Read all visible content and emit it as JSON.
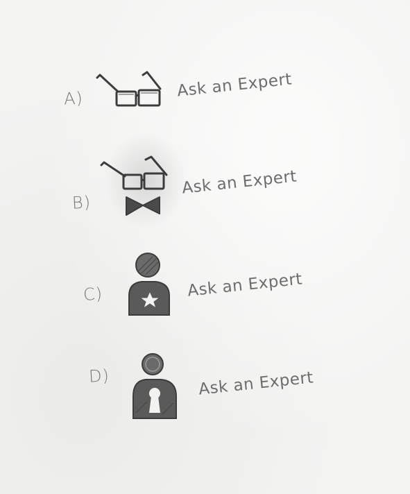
{
  "options": [
    {
      "letter": "A)",
      "label": "Ask an Expert",
      "icon": "glasses-icon"
    },
    {
      "letter": "B)",
      "label": "Ask an Expert",
      "icon": "glasses-bowtie-icon"
    },
    {
      "letter": "C)",
      "label": "Ask an Expert",
      "icon": "person-star-icon"
    },
    {
      "letter": "D)",
      "label": "Ask an Expert",
      "icon": "person-keyhole-icon"
    }
  ],
  "colors": {
    "paper": "#f3f3f2",
    "pencil": "#4a4a4a"
  }
}
